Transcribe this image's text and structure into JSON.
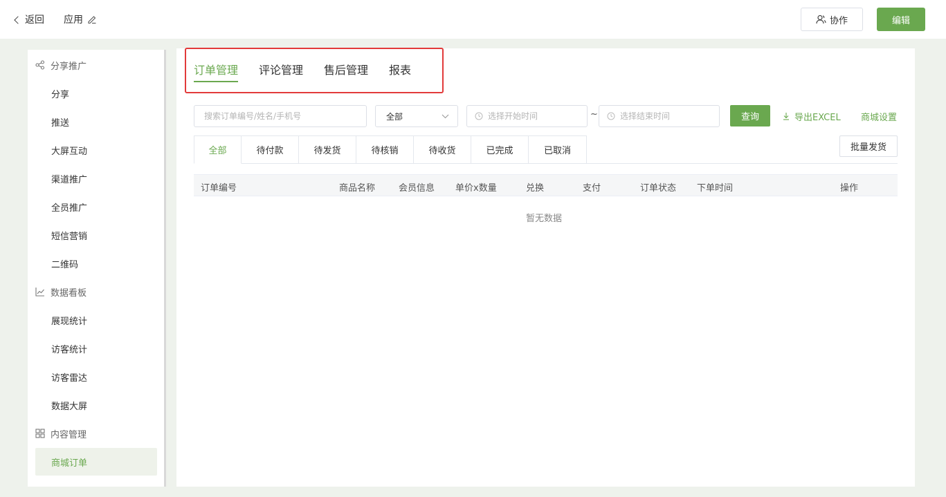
{
  "header": {
    "back_label": "返回",
    "app_title": "应用",
    "collab_label": "协作",
    "edit_label": "编辑"
  },
  "sidebar": {
    "groups": [
      {
        "label": "分享推广",
        "icon": "share-icon",
        "items": [
          "分享",
          "推送",
          "大屏互动",
          "渠道推广",
          "全员推广",
          "短信营销",
          "二维码"
        ]
      },
      {
        "label": "数据看板",
        "icon": "chart-icon",
        "items": [
          "展现统计",
          "访客统计",
          "访客雷达",
          "数据大屏"
        ]
      },
      {
        "label": "内容管理",
        "icon": "grid-icon",
        "items": [
          "商城订单"
        ]
      }
    ],
    "active_item": "商城订单"
  },
  "main": {
    "tabs": [
      "订单管理",
      "评论管理",
      "售后管理",
      "报表"
    ],
    "active_tab": "订单管理",
    "filters": {
      "search_placeholder": "搜索订单编号/姓名/手机号",
      "status_select_value": "全部",
      "start_placeholder": "选择开始时间",
      "range_separator": "~",
      "end_placeholder": "选择结束时间",
      "query_label": "查询",
      "export_label": "导出EXCEL",
      "shop_settings_label": "商城设置"
    },
    "status_tabs": [
      "全部",
      "待付款",
      "待发货",
      "待核销",
      "待收货",
      "已完成",
      "已取消"
    ],
    "active_status_tab": "全部",
    "batch_ship_label": "批量发货",
    "table": {
      "columns": [
        "订单编号",
        "商品名称",
        "会员信息",
        "单价x数量",
        "兑换",
        "支付",
        "订单状态",
        "下单时间",
        "操作"
      ],
      "empty_text": "暂无数据"
    }
  },
  "colors": {
    "accent": "#6aa84f",
    "highlight_border": "#e23a3a",
    "page_bg": "#eef2ec"
  }
}
